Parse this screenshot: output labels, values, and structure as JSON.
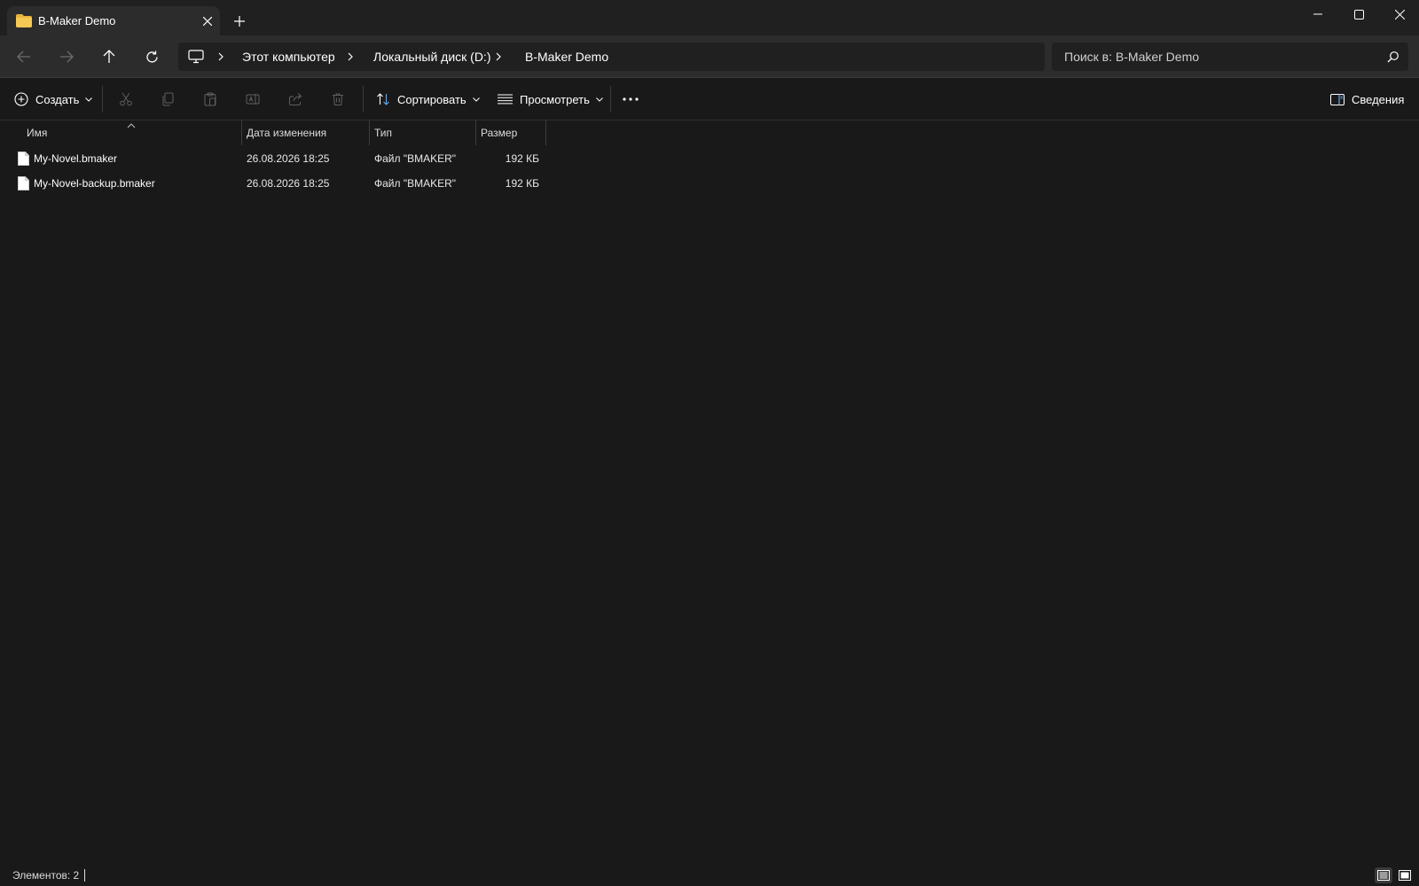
{
  "tab": {
    "title": "B-Maker Demo"
  },
  "address": {
    "breadcrumbs": [
      "Этот компьютер",
      "Локальный диск (D:)",
      "B-Maker Demo"
    ]
  },
  "search": {
    "placeholder": "Поиск в: B-Maker Demo"
  },
  "commands": {
    "create": "Создать",
    "sort": "Сортировать",
    "view": "Просмотреть",
    "details": "Сведения"
  },
  "columns": {
    "name": "Имя",
    "date": "Дата изменения",
    "type": "Тип",
    "size": "Размер"
  },
  "files": [
    {
      "name": "My-Novel.bmaker",
      "date": "26.08.2026 18:25",
      "type": "Файл \"BMAKER\"",
      "size": "192 КБ"
    },
    {
      "name": "My-Novel-backup.bmaker",
      "date": "26.08.2026 18:25",
      "type": "Файл \"BMAKER\"",
      "size": "192 КБ"
    }
  ],
  "status": {
    "items": "Элементов: 2"
  },
  "colors": {
    "background": "#191919",
    "toolbar": "#2c2c2c",
    "folder": "#f2c14e"
  },
  "icons": [
    "folder-icon",
    "close-icon",
    "plus-icon",
    "minimize-icon",
    "maximize-icon",
    "back-arrow-icon",
    "forward-arrow-icon",
    "up-arrow-icon",
    "refresh-icon",
    "computer-icon",
    "chevron-right-icon",
    "search-icon",
    "add-circle-icon",
    "cut-icon",
    "copy-icon",
    "paste-icon",
    "rename-icon",
    "share-icon",
    "delete-icon",
    "sort-icon",
    "view-icon",
    "more-icon",
    "details-pane-icon",
    "file-icon"
  ]
}
